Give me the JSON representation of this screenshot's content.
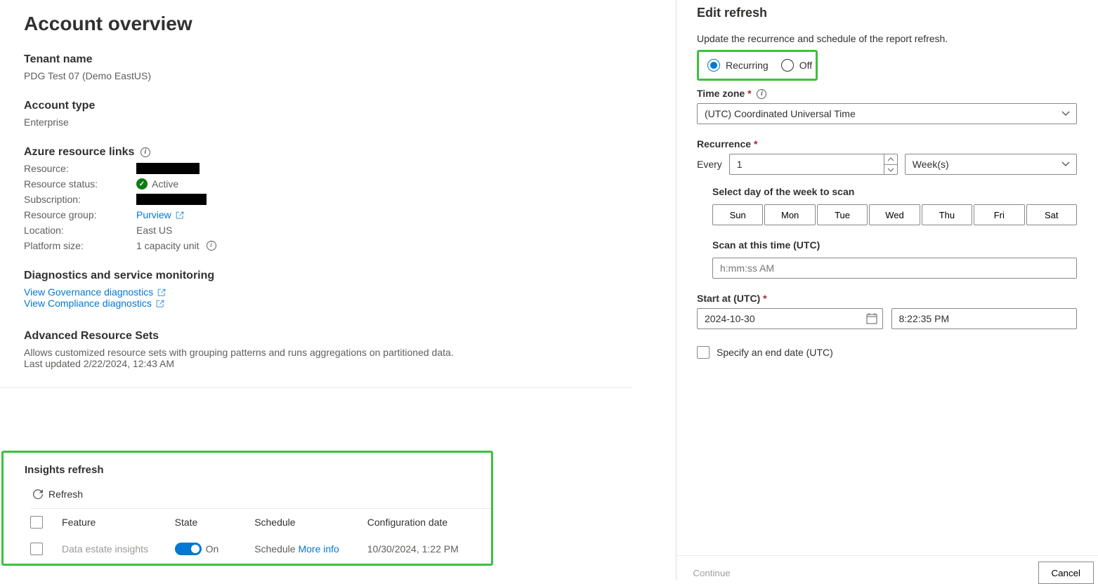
{
  "page": {
    "title": "Account overview"
  },
  "tenant": {
    "label": "Tenant name",
    "value": "PDG Test 07 (Demo EastUS)"
  },
  "account_type": {
    "label": "Account type",
    "value": "Enterprise"
  },
  "azure": {
    "heading": "Azure resource links",
    "rows": {
      "resource": {
        "label": "Resource:",
        "value": ""
      },
      "status": {
        "label": "Resource status:",
        "value": "Active"
      },
      "subscription": {
        "label": "Subscription:",
        "value": ""
      },
      "resource_group": {
        "label": "Resource group:",
        "value": "Purview"
      },
      "location": {
        "label": "Location:",
        "value": "East US"
      },
      "platform_size": {
        "label": "Platform size:",
        "value": "1 capacity unit"
      }
    }
  },
  "diagnostics": {
    "heading": "Diagnostics and service monitoring",
    "links": {
      "governance": "View Governance diagnostics",
      "compliance": "View Compliance diagnostics"
    }
  },
  "ars": {
    "heading": "Advanced Resource Sets",
    "desc": "Allows customized resource sets with grouping patterns and runs aggregations on partitioned data.",
    "updated": "Last updated 2/22/2024, 12:43 AM"
  },
  "insights": {
    "heading": "Insights refresh",
    "refresh_label": "Refresh",
    "columns": {
      "feature": "Feature",
      "state": "State",
      "schedule": "Schedule",
      "config_date": "Configuration date"
    },
    "row": {
      "feature": "Data estate insights",
      "state": "On",
      "schedule_text": "Schedule ",
      "schedule_link": "More info",
      "config_date": "10/30/2024, 1:22 PM"
    }
  },
  "edit": {
    "title": "Edit refresh",
    "desc": "Update the recurrence and schedule of the report refresh.",
    "recurring": "Recurring",
    "off": "Off",
    "tz_label": "Time zone",
    "tz_value": "(UTC) Coordinated Universal Time",
    "recurrence_label": "Recurrence",
    "every_label": "Every",
    "every_value": "1",
    "unit_value": "Week(s)",
    "select_day_label": "Select day of the week to scan",
    "days": {
      "sun": "Sun",
      "mon": "Mon",
      "tue": "Tue",
      "wed": "Wed",
      "thu": "Thu",
      "fri": "Fri",
      "sat": "Sat"
    },
    "scan_time_label": "Scan at this time (UTC)",
    "scan_time_placeholder": "h:mm:ss AM",
    "start_label": "Start at (UTC)",
    "start_date": "2024-10-30",
    "start_time": "8:22:35 PM",
    "end_date_label": "Specify an end date (UTC)",
    "footer": {
      "continue": "Continue",
      "cancel": "Cancel"
    }
  }
}
